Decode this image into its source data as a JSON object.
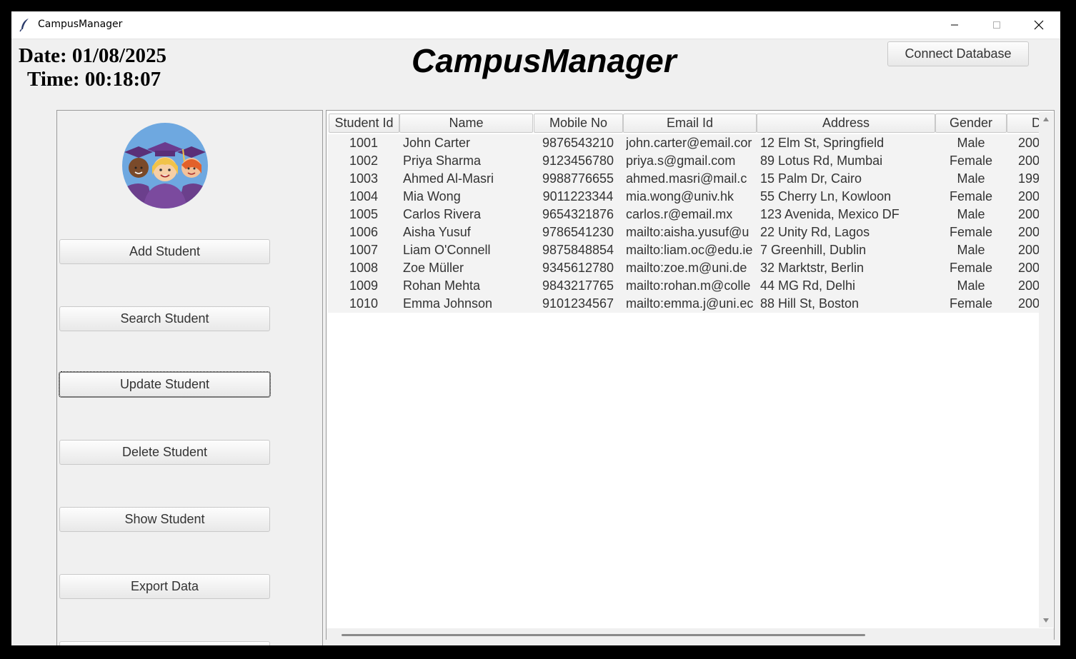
{
  "window": {
    "title": "CampusManager",
    "minimize_glyph": "—",
    "maximize_glyph": "☐",
    "close_glyph": "✕"
  },
  "header": {
    "date_text": "Date: 01/08/2025",
    "time_text": "Time: 00:18:07",
    "title": "CampusManager",
    "connect_label": "Connect Database"
  },
  "sidebar": {
    "avatar_icon": "graduates-icon",
    "buttons": [
      {
        "label": "Add Student"
      },
      {
        "label": "Search Student"
      },
      {
        "label": "Update Student"
      },
      {
        "label": "Delete Student"
      },
      {
        "label": "Show Student"
      },
      {
        "label": "Export Data"
      },
      {
        "label": ""
      }
    ]
  },
  "table": {
    "columns": [
      "Student Id",
      "Name",
      "Mobile No",
      "Email Id",
      "Address",
      "Gender",
      "D"
    ],
    "rows": [
      [
        "1001",
        "John Carter",
        "9876543210",
        "john.carter@email.cor",
        "12 Elm St, Springfield",
        "Male",
        "200"
      ],
      [
        "1002",
        "Priya Sharma",
        "9123456780",
        "priya.s@gmail.com",
        "89 Lotus Rd, Mumbai",
        "Female",
        "200"
      ],
      [
        "1003",
        "Ahmed Al-Masri",
        "9988776655",
        "ahmed.masri@mail.c",
        "15 Palm Dr, Cairo",
        "Male",
        "199"
      ],
      [
        "1004",
        "Mia Wong",
        "9011223344",
        "mia.wong@univ.hk",
        "55 Cherry Ln, Kowloon",
        "Female",
        "200"
      ],
      [
        "1005",
        "Carlos Rivera",
        "9654321876",
        "carlos.r@email.mx",
        "123 Avenida, Mexico DF",
        "Male",
        "200"
      ],
      [
        "1006",
        "Aisha Yusuf",
        "9786541230",
        "mailto:aisha.yusuf@u",
        "22 Unity Rd, Lagos",
        "Female",
        "200"
      ],
      [
        "1007",
        "Liam O'Connell",
        "9875848854",
        "mailto:liam.oc@edu.ie",
        "7 Greenhill, Dublin",
        "Male",
        "200"
      ],
      [
        "1008",
        "Zoe Müller",
        "9345612780",
        "mailto:zoe.m@uni.de",
        "32 Marktstr, Berlin",
        "Female",
        "200"
      ],
      [
        "1009",
        "Rohan Mehta",
        "9843217765",
        "mailto:rohan.m@colle",
        "44 MG Rd, Delhi",
        "Male",
        "200"
      ],
      [
        "1010",
        "Emma Johnson",
        "9101234567",
        "mailto:emma.j@uni.ec",
        "88 Hill St, Boston",
        "Female",
        "200"
      ]
    ]
  },
  "colors": {
    "window_bg": "#f0f0f0",
    "table_row_bg": "#f3f3f3"
  }
}
